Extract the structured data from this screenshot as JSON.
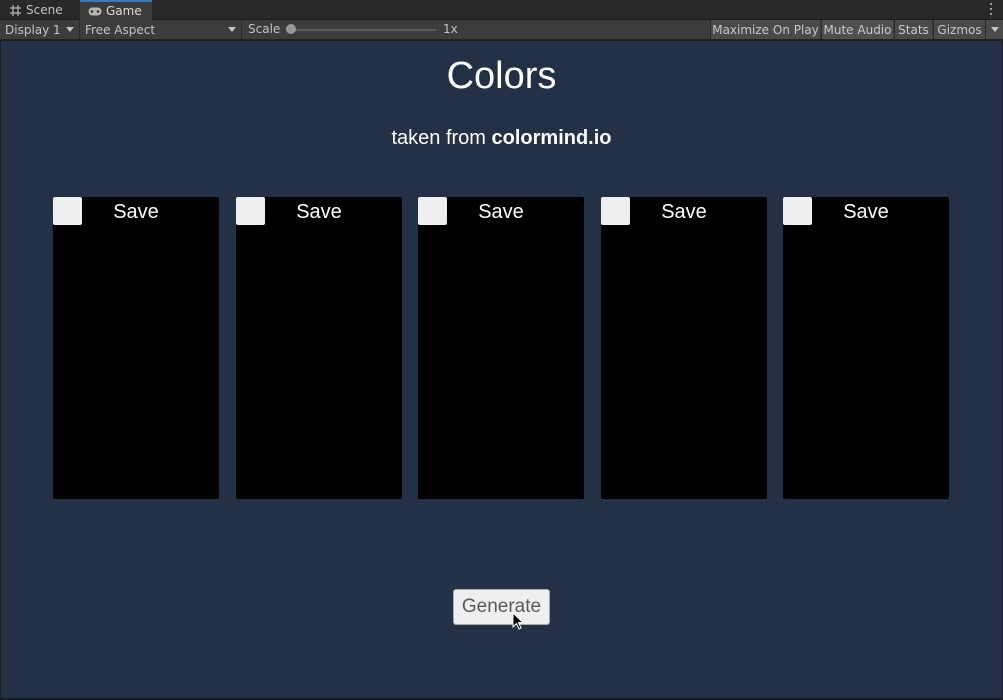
{
  "tabs": [
    {
      "label": "Scene",
      "icon": "grid-icon",
      "active": false
    },
    {
      "label": "Game",
      "icon": "gamepad-icon",
      "active": true
    }
  ],
  "toolbar": {
    "display_label": "Display 1",
    "aspect_label": "Free Aspect",
    "scale_label": "Scale",
    "scale_value": "1x",
    "maximize_label": "Maximize On Play",
    "mute_label": "Mute Audio",
    "stats_label": "Stats",
    "gizmos_label": "Gizmos"
  },
  "game": {
    "title": "Colors",
    "subtitle_prefix": "taken from",
    "subtitle_source": "colormind.io",
    "cards": [
      {
        "save_label": "Save",
        "color": "#000000"
      },
      {
        "save_label": "Save",
        "color": "#000000"
      },
      {
        "save_label": "Save",
        "color": "#000000"
      },
      {
        "save_label": "Save",
        "color": "#000000"
      },
      {
        "save_label": "Save",
        "color": "#000000"
      }
    ],
    "generate_label": "Generate"
  },
  "colors": {
    "game_background": "#233046",
    "editor_toolbar": "#3c3c3c",
    "active_tab_accent": "#3a79bb"
  }
}
